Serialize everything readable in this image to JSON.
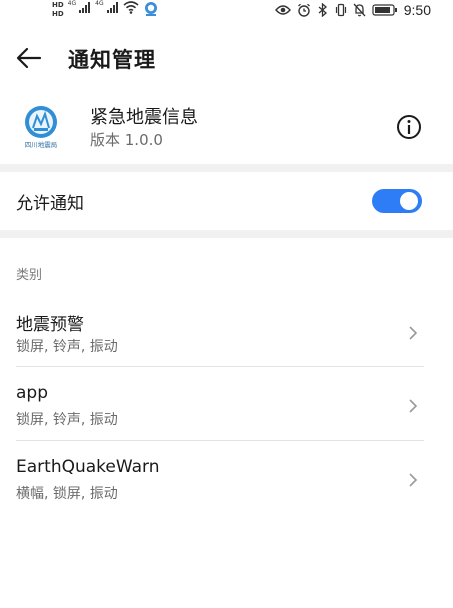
{
  "status_bar": {
    "hd_badge": "HD",
    "network_1": "4G",
    "network_2": "4G",
    "time": "9:50"
  },
  "header": {
    "title": "通知管理"
  },
  "app": {
    "name": "紧急地震信息",
    "version": "版本 1.0.0",
    "logo_caption": "四川地震局"
  },
  "allow_notifications": {
    "label": "允许通知",
    "enabled": true
  },
  "categories": {
    "section_label": "类别",
    "items": [
      {
        "title": "地震预警",
        "subtitle": "锁屏, 铃声, 振动"
      },
      {
        "title": "app",
        "subtitle": "锁屏, 铃声, 振动"
      },
      {
        "title": "EarthQuakeWarn",
        "subtitle": "横幅, 锁屏, 振动"
      }
    ]
  },
  "colors": {
    "accent": "#2e7cf6",
    "separator": "#f1f1f1",
    "secondary_text": "#6b6b6b"
  }
}
